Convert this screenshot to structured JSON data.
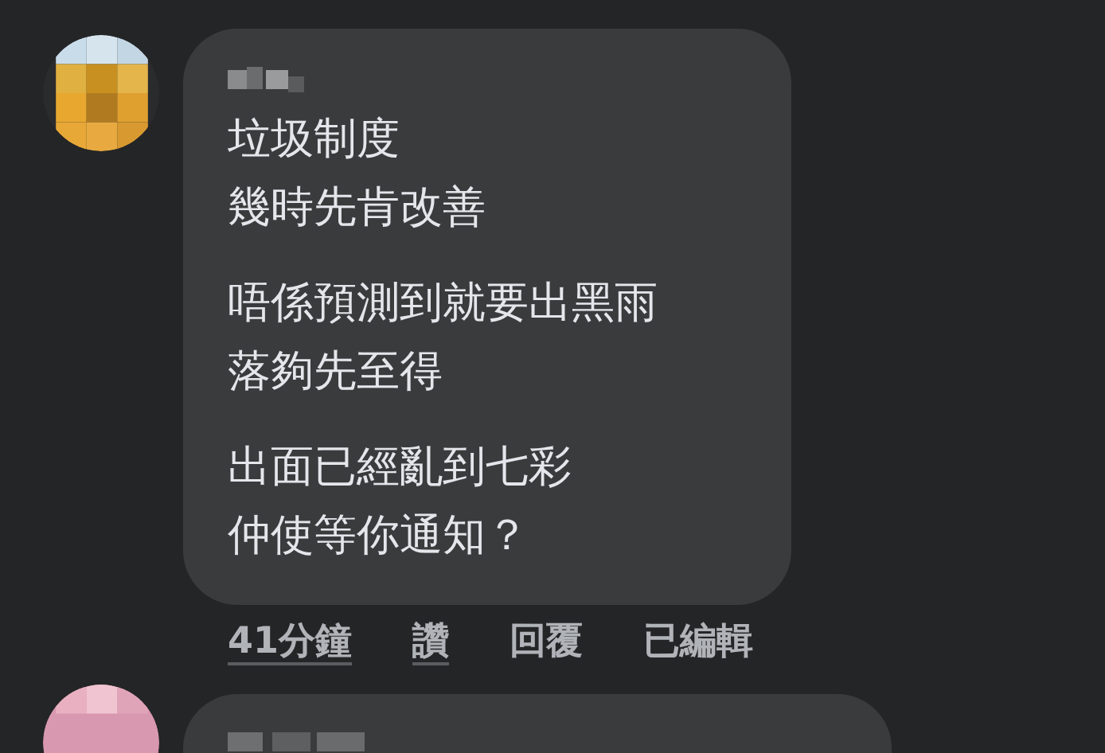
{
  "comment": {
    "paragraphs": [
      [
        "垃圾制度",
        "幾時先肯改善"
      ],
      [
        "唔係預測到就要出黑雨",
        "落夠先至得"
      ],
      [
        "出面已經亂到七彩",
        "仲使等你通知？"
      ]
    ],
    "actions": [
      {
        "label": "41分鐘",
        "underlined": true
      },
      {
        "label": "讚",
        "underlined": true
      },
      {
        "label": "回覆",
        "underlined": false
      },
      {
        "label": "已編輯",
        "underlined": false
      }
    ]
  }
}
